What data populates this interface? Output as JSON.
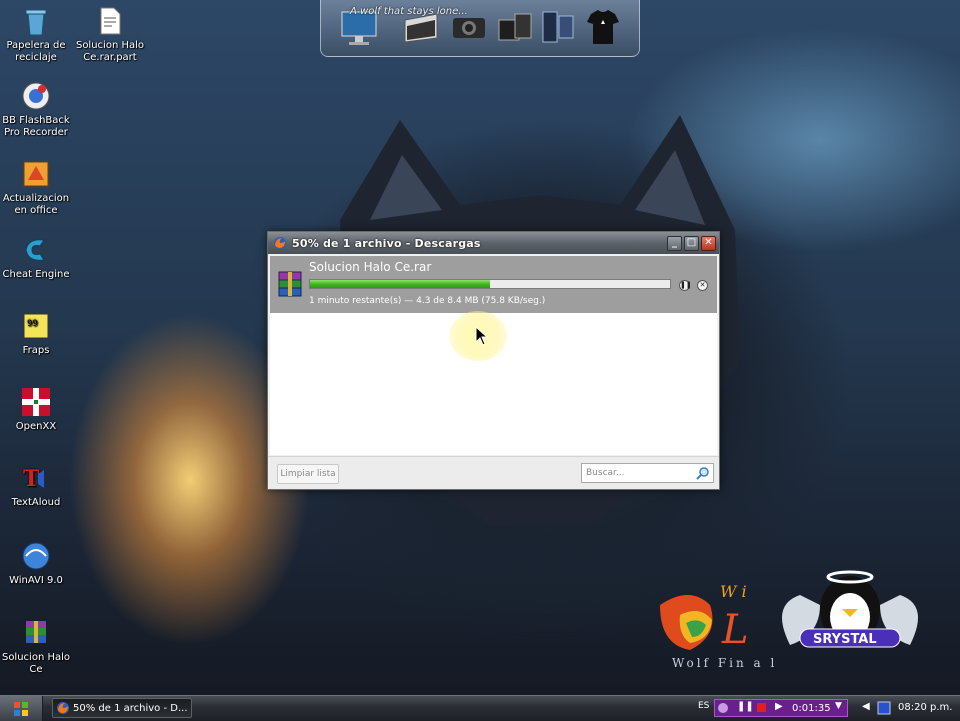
{
  "desktop": {
    "icons": [
      {
        "label": "Papelera de reciclaje",
        "icon": "recycle-bin-icon"
      },
      {
        "label": "Solucion Halo Ce.rar.part",
        "icon": "file-icon"
      },
      {
        "label": "BB FlashBack Pro Recorder",
        "icon": "recorder-icon"
      },
      {
        "label": "Actualizacion en office",
        "icon": "office-update-icon"
      },
      {
        "label": "Cheat Engine",
        "icon": "cheat-engine-icon"
      },
      {
        "label": "Fraps",
        "icon": "fraps-icon"
      },
      {
        "label": "OpenXX",
        "icon": "openxx-icon"
      },
      {
        "label": "TextAloud",
        "icon": "textaloud-icon"
      },
      {
        "label": "WinAVI 9.0",
        "icon": "winavi-icon"
      },
      {
        "label": "Solucion Halo Ce",
        "icon": "winrar-icon"
      }
    ]
  },
  "dock": {
    "caption": "A wolf that stays lone..."
  },
  "window": {
    "title": "50% de 1 archivo - Descargas",
    "download": {
      "name": "Solucion Halo Ce.rar",
      "progress": 0.5,
      "status": "1 minuto restante(s) — 4.3 de 8.4 MB (75.8 KB/seg.)"
    },
    "clear_label": "Limpiar lista",
    "search_placeholder": "Buscar..."
  },
  "taskbar": {
    "task_label": "50% de 1 archivo - D...",
    "lang": "ES",
    "rec_time": "0:01:35",
    "clock": "08:20 p.m."
  },
  "branding": {
    "text_top": "W i      s",
    "text_mid": "L",
    "text_bottom": "Wolf Fin a l      o n",
    "badge": "SRYSTAL"
  },
  "colors": {
    "progress_fill": "#3fb21d",
    "title_bar": "#5d636b",
    "recorder": "#6a1f8f"
  }
}
